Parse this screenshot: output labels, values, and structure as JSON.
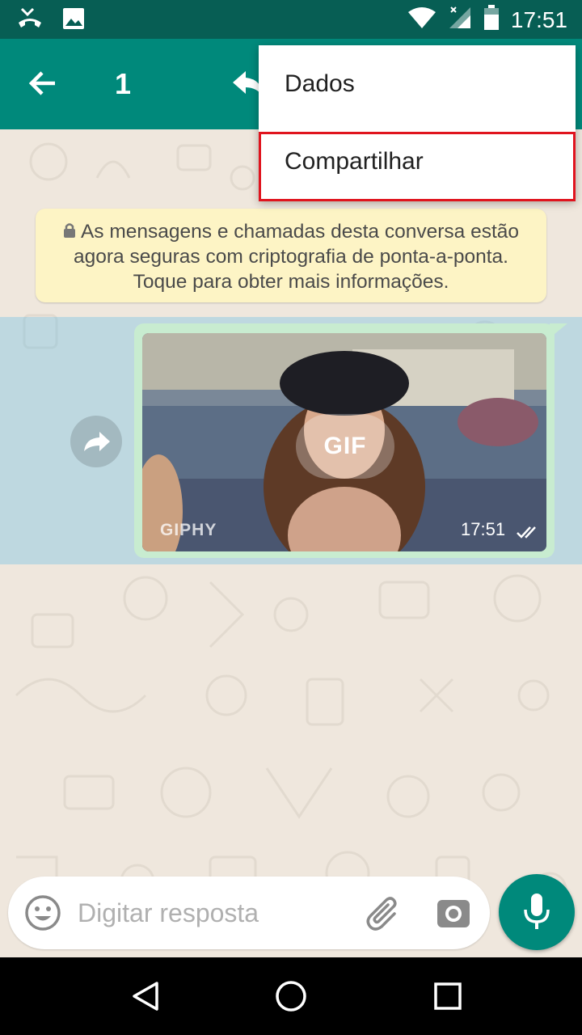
{
  "status_bar": {
    "time": "17:51",
    "icons": [
      "missed-call-icon",
      "image-icon",
      "wifi-icon",
      "signal-icon",
      "battery-icon"
    ]
  },
  "header": {
    "selected_count": "1",
    "icons": [
      "back-arrow-icon",
      "reply-icon"
    ]
  },
  "menu": {
    "items": [
      {
        "label": "Dados"
      },
      {
        "label": "Compartilhar",
        "highlighted": true
      }
    ],
    "highlight_color": "#e0141e"
  },
  "chat": {
    "encryption_notice": "As mensagens e chamadas desta conversa estão agora seguras com criptografia de ponta-a-ponta. Toque para obter mais informações.",
    "message": {
      "badge": "GIF",
      "watermark": "GIPHY",
      "time": "17:51",
      "status_icon": "double-check-icon"
    }
  },
  "composer": {
    "placeholder": "Digitar resposta",
    "icons": [
      "emoji-icon",
      "attach-icon",
      "camera-icon",
      "mic-icon"
    ]
  },
  "colors": {
    "header": "#00897b",
    "status_bar": "#075e54",
    "accent": "#00897b",
    "bubble": "#c8ecd0",
    "notice": "#fdf4c5"
  }
}
